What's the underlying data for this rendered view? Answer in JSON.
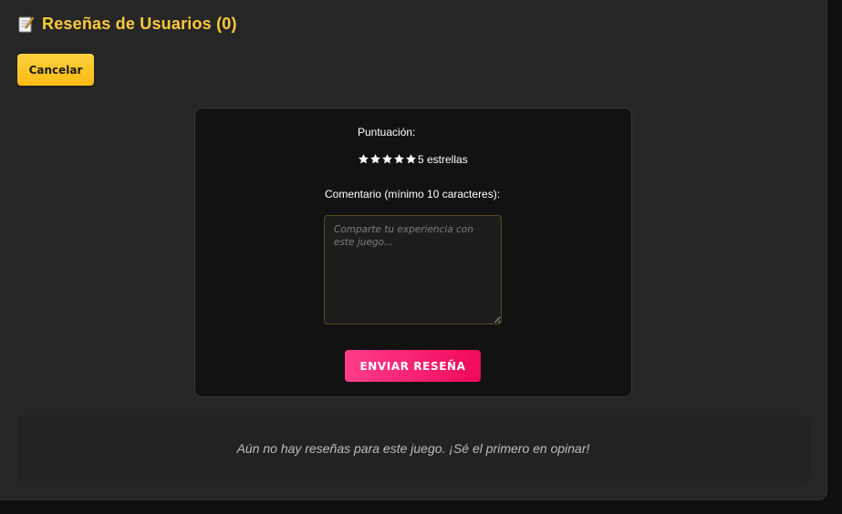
{
  "header": {
    "icon": "memo-icon",
    "title": "Reseñas de Usuarios (0)"
  },
  "actions": {
    "cancel_label": "Cancelar"
  },
  "form": {
    "score_label": "Puntuación:",
    "rating": {
      "value": 5,
      "max": 5,
      "text": "5 estrellas",
      "star_icon": "star-icon"
    },
    "comment_label": "Comentario (mínimo 10 caracteres):",
    "comment_value": "",
    "comment_placeholder": "Comparte tu experiencia con este juego...",
    "submit_label": "ENVIAR RESEÑA"
  },
  "empty_state": {
    "message": "Aún no hay reseñas para este juego. ¡Sé el primero en opinar!"
  },
  "colors": {
    "accent_yellow": "#ffc93c",
    "button_pink": "#f0095c",
    "panel_bg": "#262626",
    "card_bg": "#121212"
  }
}
